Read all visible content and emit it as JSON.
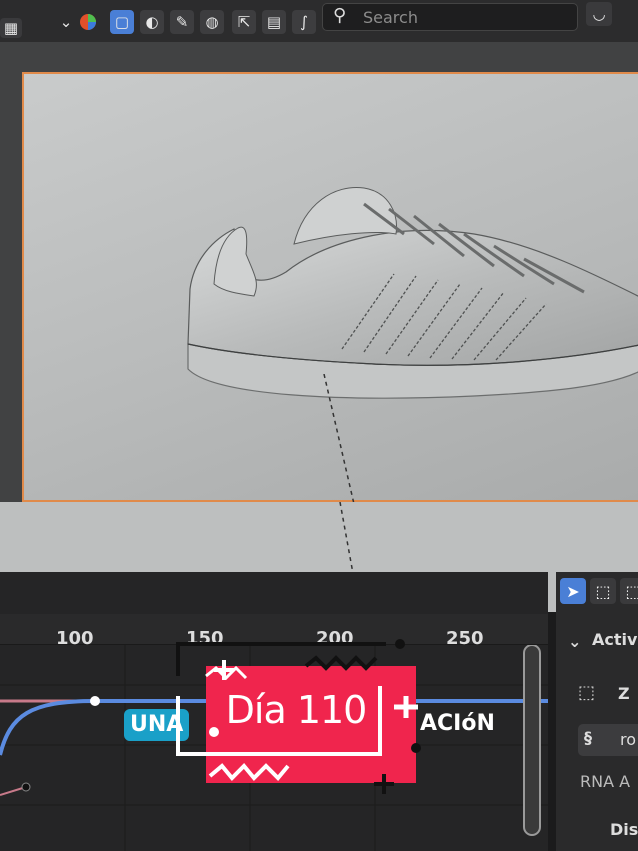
{
  "header": {
    "search_placeholder": "Search",
    "icons": [
      "menu-icon",
      "chevron-down-icon",
      "color-sphere-icon",
      "select-box-icon",
      "solid-shading-icon",
      "material-icon",
      "world-icon",
      "export-icon",
      "editor-icon",
      "curves-icon",
      "search-icon",
      "minimize-icon"
    ]
  },
  "timeline": {
    "ruler_ticks": [
      "100",
      "150",
      "200",
      "250"
    ]
  },
  "properties": {
    "panel_title": "Activ",
    "row1": "Z",
    "row2": "ro",
    "row3": "RNA A",
    "row4": "Dis"
  },
  "overlay": {
    "day_label": "Día 110",
    "left_word": "UNA",
    "right_word": "ACIóN"
  },
  "colors": {
    "accent_blue": "#4a7fd6",
    "overlay_red": "#f0254d",
    "tag_cyan": "#1aa0c8",
    "frame_orange": "#e08a4a"
  }
}
